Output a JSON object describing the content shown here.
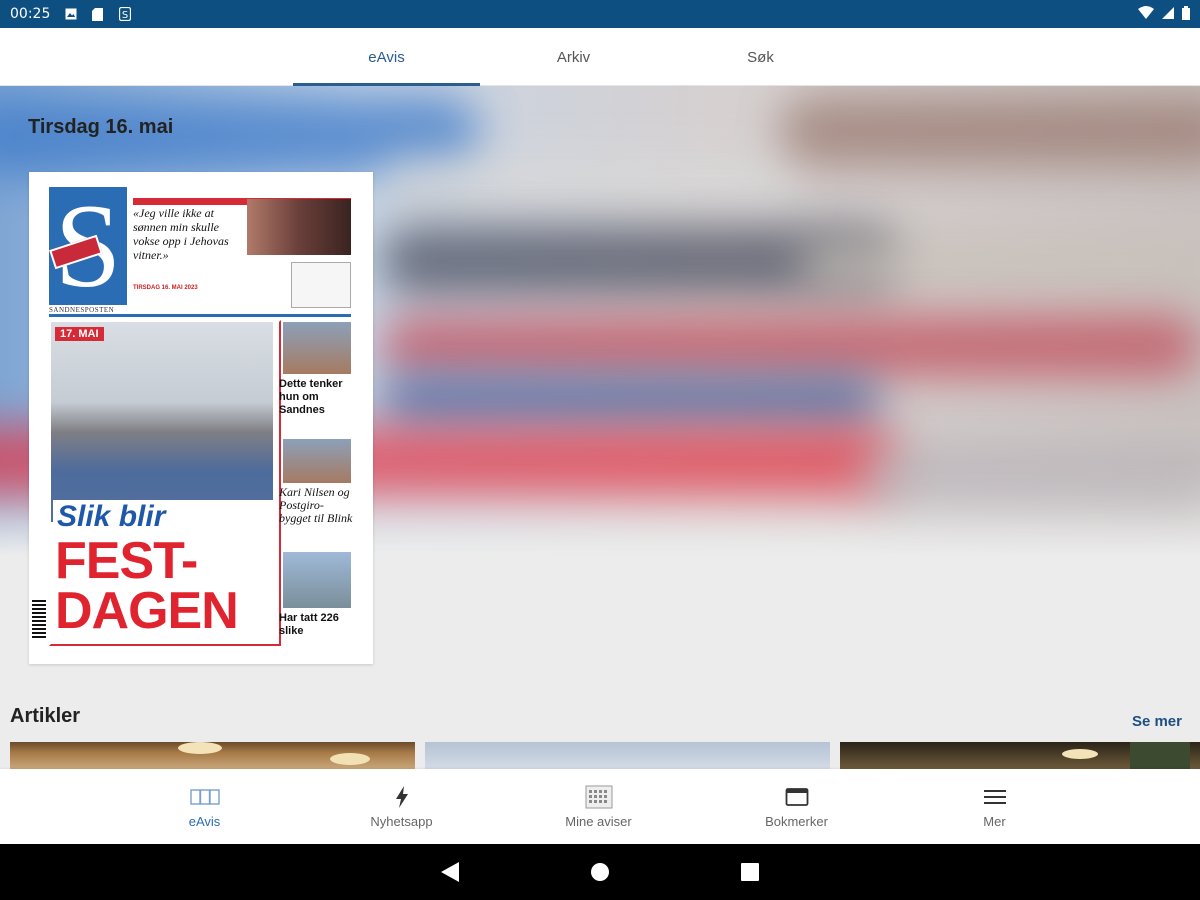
{
  "status_bar": {
    "time": "00:25"
  },
  "top_tabs": [
    {
      "label": "eAvis",
      "active": true
    },
    {
      "label": "Arkiv",
      "active": false
    },
    {
      "label": "Søk",
      "active": false
    }
  ],
  "hero": {
    "date": "Tirsdag 16. mai"
  },
  "newspaper": {
    "masthead_letter": "S",
    "publication_name": "SANDNESPOSTEN",
    "date_line": "TIRSDAG 16. MAI 2023",
    "quote": "«Jeg ville ikke at sønnen min skulle vokse opp i Jehovas vitner.»",
    "badge": "17. MAI",
    "headline_line1": "Slik blir",
    "headline_line2": "FEST-DAGEN",
    "side_story_1": "Dette tenker hun om Sandnes",
    "side_story_2": "Kari Nilsen og Postgiro-bygget til Blink",
    "side_story_3": "Har tatt 226 slike"
  },
  "articles": {
    "heading": "Artikler",
    "see_more": "Se mer"
  },
  "bottom_nav": [
    {
      "label": "eAvis",
      "icon": "newspaper-icon",
      "active": true
    },
    {
      "label": "Nyhetsapp",
      "icon": "lightning-icon",
      "active": false
    },
    {
      "label": "Mine aviser",
      "icon": "calendar-grid-icon",
      "active": false
    },
    {
      "label": "Bokmerker",
      "icon": "bookmark-box-icon",
      "active": false
    },
    {
      "label": "Mer",
      "icon": "hamburger-menu-icon",
      "active": false
    }
  ],
  "colors": {
    "status_bar": "#0e4f82",
    "accent": "#2b6db4",
    "link": "#1f4f82",
    "headline_red": "#e0242f"
  }
}
